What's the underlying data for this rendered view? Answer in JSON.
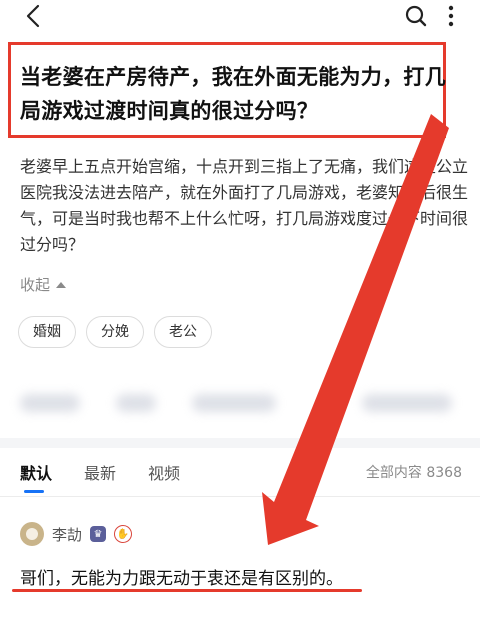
{
  "header": {
    "back_icon": "chevron-left-icon",
    "search_icon": "search-icon",
    "more_icon": "vertical-dots-icon"
  },
  "question": {
    "title": "当老婆在产房待产，我在外面无能为力，打几局游戏过渡时间真的很过分吗？",
    "body": "老婆早上五点开始宫缩，十点开到三指上了无痛，我们这是公立医院我没法进去陪产，就在外面打了几局游戏，老婆知道后很生气，可是当时我也帮不上什么忙呀，打几局游戏度过一下时间很过分吗？",
    "collapse_label": "收起",
    "tags": [
      "婚姻",
      "分娩",
      "老公"
    ]
  },
  "tabs": {
    "items": [
      "默认",
      "最新",
      "视频"
    ],
    "active": "默认",
    "total_label": "全部内容 8368"
  },
  "answer": {
    "author": "李劼",
    "text": "哥们，无能为力跟无动于衷还是有区别的。"
  },
  "colors": {
    "annotation_red": "#e53a2c",
    "accent_blue": "#1772f6"
  }
}
